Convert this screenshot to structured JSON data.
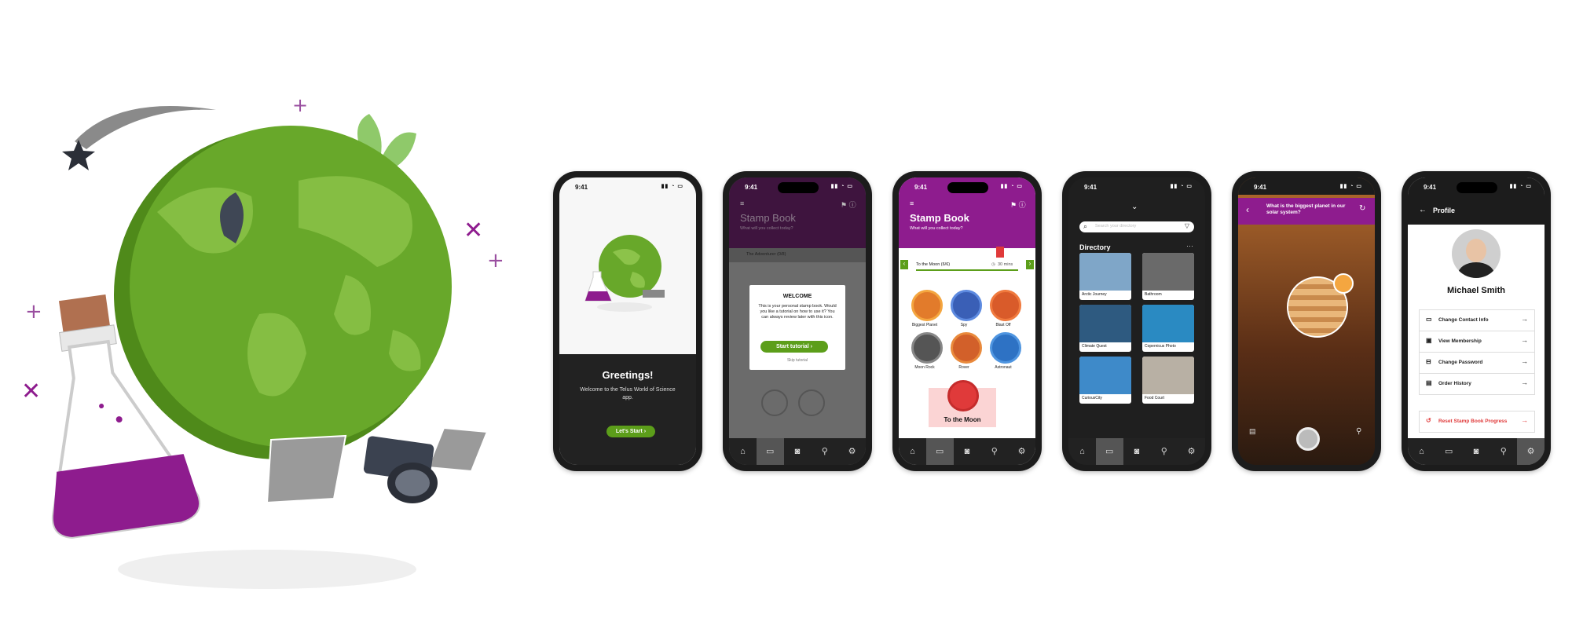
{
  "phones": {
    "greeting": {
      "time": "9:41",
      "title": "Greetings!",
      "body": "Welcome to the Telus World of Science app.",
      "cta": "Let's Start"
    },
    "tutorial": {
      "time": "9:41",
      "title": "Stamp Book",
      "subtitle": "What will you collect today?",
      "collection": "The Adventurer (0/8)",
      "modal_title": "WELCOME",
      "modal_body": "This is your personal stamp book. Would you like a tutorial on how to use it? You can always review later with this icon.",
      "start_button": "Start tutorial",
      "skip_link": "Skip tutorial"
    },
    "stampbook": {
      "time": "9:41",
      "title": "Stamp Book",
      "subtitle": "What will you collect today?",
      "collection": "To the Moon (6/6)",
      "duration": "30 mins",
      "stamps": [
        "Biggest Planet",
        "Spy",
        "Blast Off",
        "Moon Rock",
        "Rover",
        "Astronaut"
      ],
      "reward": "To the Moon"
    },
    "directory": {
      "time": "9:41",
      "search_placeholder": "Search your directory",
      "heading": "Directory",
      "items": [
        "Arctic Journey",
        "Bathroom",
        "Climate Quest",
        "Copernicus Photo",
        "CuriousCity",
        "Food Court"
      ]
    },
    "quiz": {
      "time": "9:41",
      "question": "What is the biggest planet in our solar system?"
    },
    "profile": {
      "time": "9:41",
      "title": "Profile",
      "name": "Michael Smith",
      "menu": [
        "Change Contact Info",
        "View Membership",
        "Change Password",
        "Order History"
      ],
      "reset": "Reset Stamp Book Progress"
    }
  },
  "colors": {
    "purple": "#8e1c8e",
    "green": "#5c9e1a",
    "dark": "#1c1c1c",
    "red": "#e03a3a"
  },
  "icons": [
    "home-icon",
    "book-icon",
    "camera-icon",
    "map-pin-icon",
    "gear-icon"
  ]
}
